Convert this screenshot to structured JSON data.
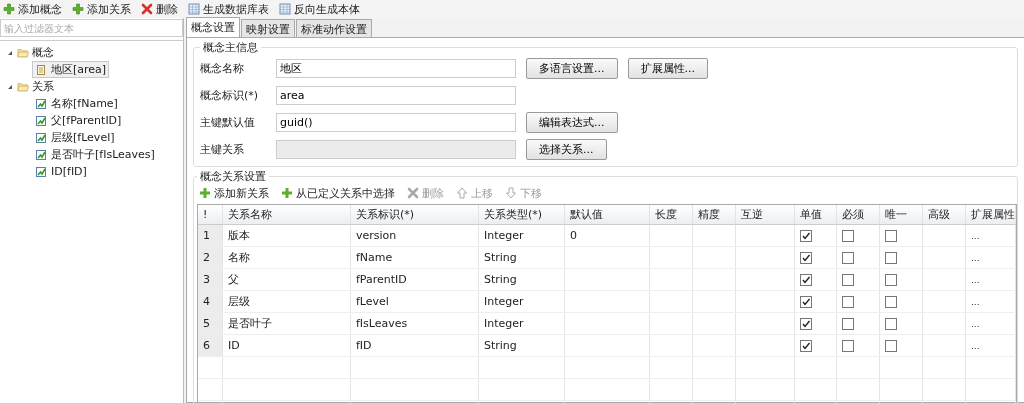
{
  "toolbar": [
    {
      "label": "添加概念",
      "kind": "add"
    },
    {
      "label": "添加关系",
      "kind": "add"
    },
    {
      "label": "删除",
      "kind": "delete"
    },
    {
      "label": "生成数据库表",
      "kind": "table"
    },
    {
      "label": "反向生成本体",
      "kind": "table"
    }
  ],
  "filter": {
    "placeholder": "输入过滤器文本"
  },
  "tree": [
    {
      "label": "概念",
      "expanded": true,
      "children": [
        {
          "label": "地区[area]",
          "kind": "entity",
          "selected": true
        }
      ]
    },
    {
      "label": "关系",
      "expanded": true,
      "children": [
        {
          "label": "名称[fName]",
          "kind": "relation",
          "selected": false
        },
        {
          "label": "父[fParentID]",
          "kind": "relation",
          "selected": false
        },
        {
          "label": "层级[fLevel]",
          "kind": "relation",
          "selected": false
        },
        {
          "label": "是否叶子[fIsLeaves]",
          "kind": "relation",
          "selected": false
        },
        {
          "label": "ID[fID]",
          "kind": "relation",
          "selected": false
        }
      ]
    }
  ],
  "tabs": [
    {
      "label": "概念设置",
      "selected": true
    },
    {
      "label": "映射设置",
      "selected": false
    },
    {
      "label": "标准动作设置",
      "selected": false
    }
  ],
  "main_info": {
    "title": "概念主信息",
    "fields": [
      {
        "label": "概念名称",
        "value": "地区",
        "disabled": false,
        "buttons": [
          "多语言设置...",
          "扩展属性..."
        ]
      },
      {
        "label": "概念标识(*)",
        "value": "area",
        "disabled": false
      },
      {
        "label": "主键默认值",
        "value": "guid()",
        "disabled": false,
        "buttons": [
          "编辑表达式..."
        ]
      },
      {
        "label": "主键关系",
        "disabled": true,
        "buttons": [
          "选择关系..."
        ]
      }
    ]
  },
  "relations": {
    "title": "概念关系设置",
    "toolbar": [
      {
        "label": "添加新关系",
        "kind": "add",
        "disabled": false
      },
      {
        "label": "从已定义关系中选择",
        "kind": "add",
        "disabled": false
      },
      {
        "label": "删除",
        "kind": "delete",
        "disabled": true
      },
      {
        "label": "上移",
        "kind": "up",
        "disabled": true
      },
      {
        "label": "下移",
        "kind": "down",
        "disabled": true
      }
    ],
    "columns": [
      "!",
      "关系名称",
      "关系标识(*)",
      "关系类型(*)",
      "默认值",
      "长度",
      "精度",
      "互逆",
      "单值",
      "必须",
      "唯一",
      "高级",
      "扩展属性"
    ],
    "rows": [
      {
        "number": "1",
        "name": "版本",
        "id": "version",
        "type": "Integer",
        "default": "0",
        "single": true,
        "required": false,
        "unique": false,
        "ext": "..."
      },
      {
        "number": "2",
        "name": "名称",
        "id": "fName",
        "type": "String",
        "single": true,
        "required": false,
        "unique": false,
        "ext": "..."
      },
      {
        "number": "3",
        "name": "父",
        "id": "fParentID",
        "type": "String",
        "single": true,
        "required": false,
        "unique": false,
        "ext": "..."
      },
      {
        "number": "4",
        "name": "层级",
        "id": "fLevel",
        "type": "Integer",
        "single": true,
        "required": false,
        "unique": false,
        "ext": "..."
      },
      {
        "number": "5",
        "name": "是否叶子",
        "id": "fIsLeaves",
        "type": "Integer",
        "single": true,
        "required": false,
        "unique": false,
        "ext": "..."
      },
      {
        "number": "6",
        "name": "ID",
        "id": "fID",
        "type": "String",
        "single": true,
        "required": false,
        "unique": false,
        "ext": "..."
      }
    ]
  }
}
